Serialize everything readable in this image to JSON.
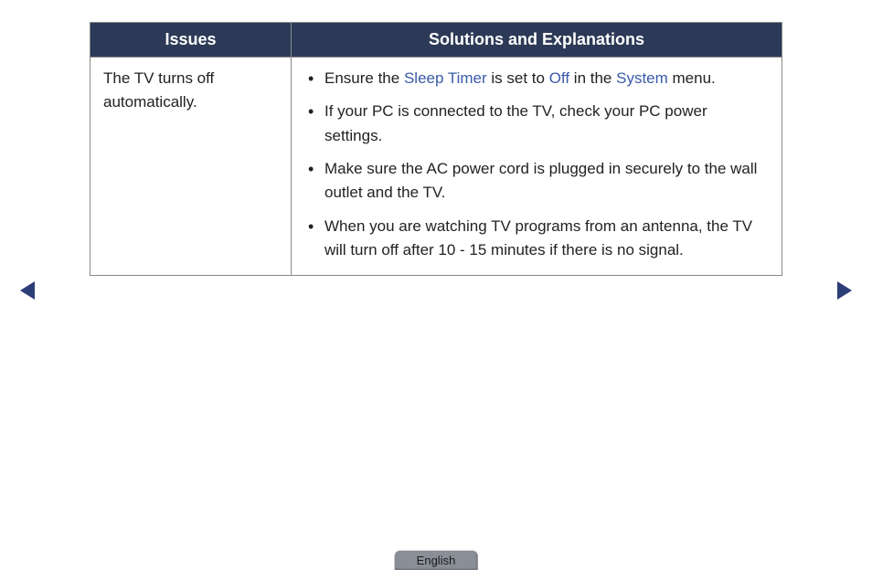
{
  "table": {
    "headers": {
      "issues": "Issues",
      "solutions": "Solutions and Explanations"
    },
    "row": {
      "issue": "The TV turns off automatically.",
      "solutions": {
        "item1": {
          "pre": "Ensure the ",
          "link1": "Sleep Timer",
          "mid1": " is set to ",
          "link2": "Off",
          "mid2": " in the ",
          "link3": "System",
          "post": " menu."
        },
        "item2": "If your PC is connected to the TV, check your PC power settings.",
        "item3": "Make sure the AC power cord is plugged in securely to the wall outlet and the TV.",
        "item4": "When you are watching TV programs from an antenna, the TV will turn off after 10 - 15 minutes if there is no signal."
      }
    }
  },
  "footer": {
    "language": "English"
  }
}
